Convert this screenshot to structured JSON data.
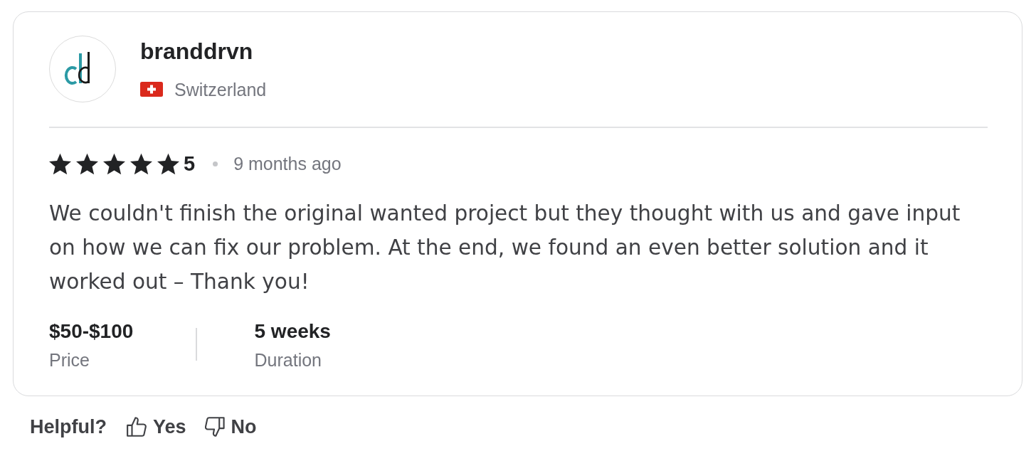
{
  "reviewer": {
    "name": "branddrvn",
    "country": "Switzerland"
  },
  "review": {
    "stars": 5,
    "rating": "5",
    "time": "9 months ago",
    "text": "We couldn't finish the original wanted project but they thought with us and gave input on how we can fix our problem. At the end, we found an even better solution and it worked out – Thank you!"
  },
  "details": [
    {
      "value": "$50-$100",
      "label": "Price"
    },
    {
      "value": "5 weeks",
      "label": "Duration"
    }
  ],
  "helpful": {
    "label": "Helpful?",
    "buttons": [
      {
        "kind": "up",
        "label": "Yes"
      },
      {
        "kind": "down",
        "label": "No"
      }
    ]
  }
}
